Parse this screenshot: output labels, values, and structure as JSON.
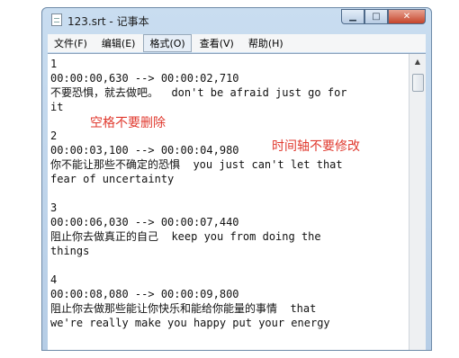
{
  "window": {
    "title": "123.srt - 记事本",
    "buttons": {
      "minimize": "▁",
      "maximize": "□",
      "close": "✕"
    }
  },
  "menu": [
    "文件(F)",
    "编辑(E)",
    "格式(O)",
    "查看(V)",
    "帮助(H)"
  ],
  "editor": {
    "lines": [
      "1",
      "00:00:00,630 --> 00:00:02,710",
      "不要恐惧，就去做吧。  don't be afraid just go for",
      "it",
      "",
      "2",
      "00:00:03,100 --> 00:00:04,980",
      "你不能让那些不确定的恐惧  you just can't let that",
      "fear of uncertainty",
      "",
      "3",
      "00:00:06,030 --> 00:00:07,440",
      "阻止你去做真正的自己  keep you from doing the",
      "things",
      "",
      "4",
      "00:00:08,080 --> 00:00:09,800",
      "阻止你去做那些能让你快乐和能给你能量的事情  that",
      "we're really make you happy put your energy"
    ]
  },
  "annotations": {
    "space_note": "空格不要删除",
    "timeline_note": "时间轴不要修改"
  },
  "colors": {
    "annotation": "#e03a2f"
  }
}
